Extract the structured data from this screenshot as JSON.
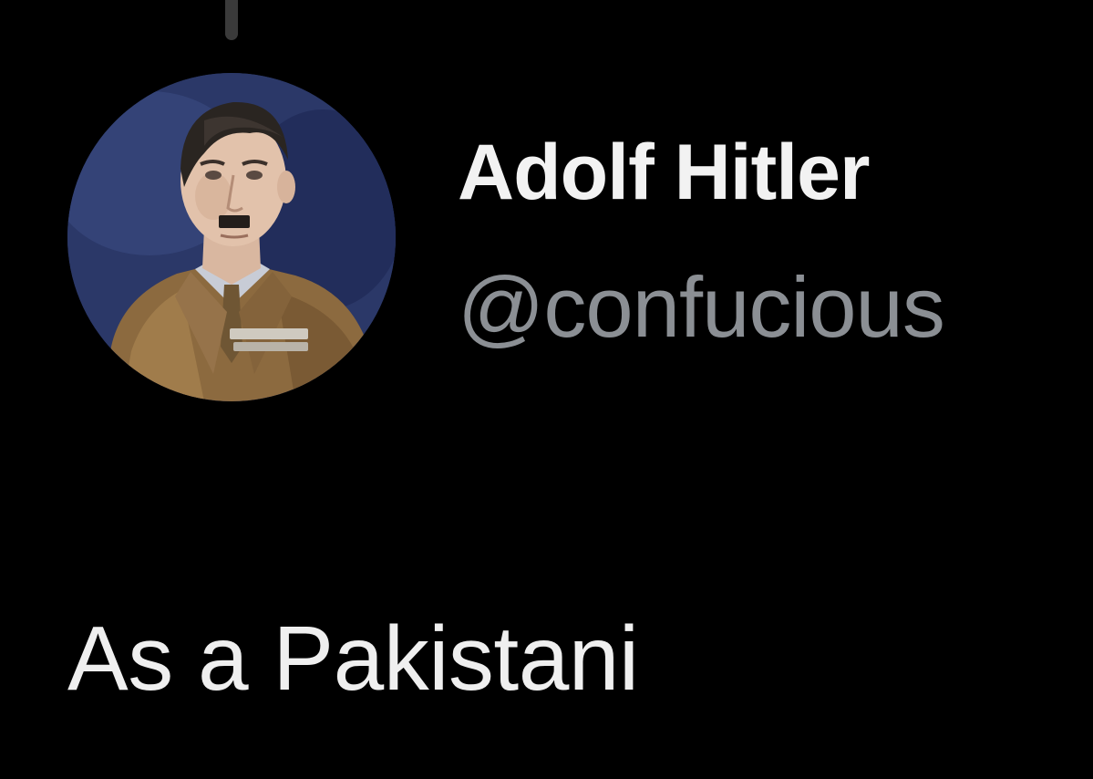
{
  "tweet": {
    "author": {
      "display_name": "Adolf Hitler",
      "handle": "@confucious"
    },
    "text": "As a Pakistani"
  },
  "colors": {
    "background": "#000000",
    "name_text": "#f2f2f2",
    "handle_text": "#8b8f94",
    "body_text": "#efefef"
  }
}
